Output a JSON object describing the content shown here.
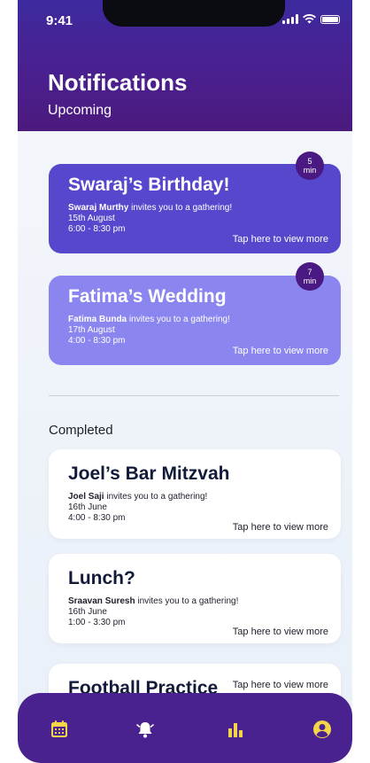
{
  "status_bar": {
    "time": "9:41"
  },
  "header": {
    "title": "Notifications",
    "subtitle": "Upcoming"
  },
  "upcoming": [
    {
      "title": "Swaraj’s Birthday!",
      "host": "Swaraj Murthy",
      "invite_text": "invites you to a gathering!",
      "date": "15th August",
      "time": "6:00 - 8:30 pm",
      "cta": "Tap here to view more",
      "badge_num": "5",
      "badge_unit": "min"
    },
    {
      "title": "Fatima’s Wedding",
      "host": "Fatima Bunda",
      "invite_text": "invites you to a gathering!",
      "date": "17th August",
      "time": "4:00 - 8:30 pm",
      "cta": "Tap here to view more",
      "badge_num": "7",
      "badge_unit": "min"
    }
  ],
  "completed_label": "Completed",
  "completed": [
    {
      "title": "Joel’s Bar Mitzvah",
      "host": "Joel Saji",
      "invite_text": "invites you to a gathering!",
      "date": "16th June",
      "time": "4:00 - 8:30 pm",
      "cta": "Tap here to view more"
    },
    {
      "title": "Lunch?",
      "host": "Sraavan Suresh",
      "invite_text": "invites you to a gathering!",
      "date": "16th June",
      "time": "1:00 - 3:30 pm",
      "cta": "Tap here to view more"
    },
    {
      "title": "Football Practice",
      "cta": "Tap here to view more"
    }
  ],
  "nav": {
    "items": [
      {
        "icon": "calendar-icon"
      },
      {
        "icon": "bell-icon"
      },
      {
        "icon": "bar-chart-icon"
      },
      {
        "icon": "user-icon"
      }
    ]
  },
  "colors": {
    "header": "#4a228f",
    "card_primary": "#5647cc",
    "card_secondary": "#8b86ef",
    "badge": "#4a1a82",
    "nav": "#4a228f"
  }
}
